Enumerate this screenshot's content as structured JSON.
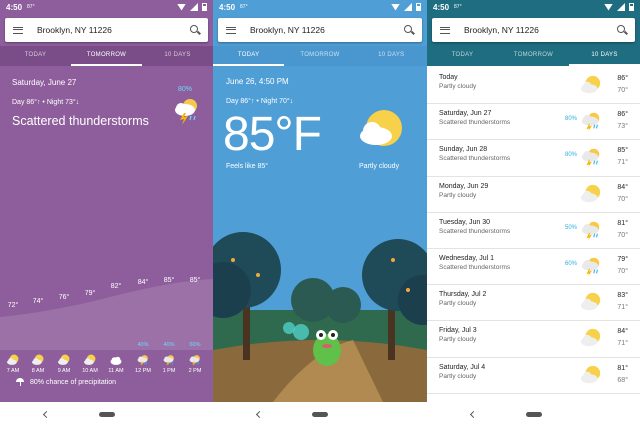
{
  "status": {
    "time": "4:50",
    "temp_small": "87°"
  },
  "search": {
    "location": "Brooklyn, NY 11226"
  },
  "tabs": [
    "TODAY",
    "TOMORROW",
    "10 DAYS"
  ],
  "panel1": {
    "date": "Saturday, June 27",
    "day_night": "Day 86°↑ • Night 73°↓",
    "condition": "Scattered thunderstorms",
    "precip_pct": "80%",
    "hours": [
      {
        "time": "7 AM",
        "temp": "72°",
        "icon": "partly-cloudy-icon",
        "pct": ""
      },
      {
        "time": "8 AM",
        "temp": "74°",
        "icon": "partly-cloudy-icon",
        "pct": ""
      },
      {
        "time": "9 AM",
        "temp": "76°",
        "icon": "partly-cloudy-icon",
        "pct": ""
      },
      {
        "time": "10 AM",
        "temp": "79°",
        "icon": "partly-cloudy-icon",
        "pct": ""
      },
      {
        "time": "11 AM",
        "temp": "82°",
        "icon": "cloudy-icon",
        "pct": ""
      },
      {
        "time": "12 PM",
        "temp": "84°",
        "icon": "thunderstorm-icon",
        "pct": "40%"
      },
      {
        "time": "1 PM",
        "temp": "85°",
        "icon": "thunderstorm-icon",
        "pct": "40%"
      },
      {
        "time": "2 PM",
        "temp": "85°",
        "icon": "thunderstorm-icon",
        "pct": "60%"
      }
    ],
    "chance_text": "80% chance of precipitation"
  },
  "panel2": {
    "datetime": "June 26, 4:50 PM",
    "day_night": "Day 86°↑ • Night 70°↓",
    "temp": "85°F",
    "feels_like": "Feels like 85°",
    "condition": "Partly cloudy"
  },
  "panel3": {
    "days": [
      {
        "day": "Today",
        "cond": "Partly cloudy",
        "pct": "",
        "icon": "partly-cloudy-icon",
        "hi": "86°",
        "lo": "70°"
      },
      {
        "day": "Saturday, Jun 27",
        "cond": "Scattered thunderstorms",
        "pct": "80%",
        "icon": "thunderstorm-icon",
        "hi": "86°",
        "lo": "73°"
      },
      {
        "day": "Sunday, Jun 28",
        "cond": "Scattered thunderstorms",
        "pct": "80%",
        "icon": "thunderstorm-icon",
        "hi": "85°",
        "lo": "71°"
      },
      {
        "day": "Monday, Jun 29",
        "cond": "Partly cloudy",
        "pct": "",
        "icon": "partly-cloudy-icon",
        "hi": "84°",
        "lo": "70°"
      },
      {
        "day": "Tuesday, Jun 30",
        "cond": "Scattered thunderstorms",
        "pct": "50%",
        "icon": "thunderstorm-icon",
        "hi": "81°",
        "lo": "70°"
      },
      {
        "day": "Wednesday, Jul 1",
        "cond": "Scattered thunderstorms",
        "pct": "60%",
        "icon": "thunderstorm-icon",
        "hi": "79°",
        "lo": "70°"
      },
      {
        "day": "Thursday, Jul 2",
        "cond": "Partly cloudy",
        "pct": "",
        "icon": "partly-cloudy-icon",
        "hi": "83°",
        "lo": "71°"
      },
      {
        "day": "Friday, Jul 3",
        "cond": "Partly cloudy",
        "pct": "",
        "icon": "partly-cloudy-icon",
        "hi": "84°",
        "lo": "71°"
      },
      {
        "day": "Saturday, Jul 4",
        "cond": "Partly cloudy",
        "pct": "",
        "icon": "partly-cloudy-icon",
        "hi": "81°",
        "lo": "68°"
      }
    ]
  }
}
